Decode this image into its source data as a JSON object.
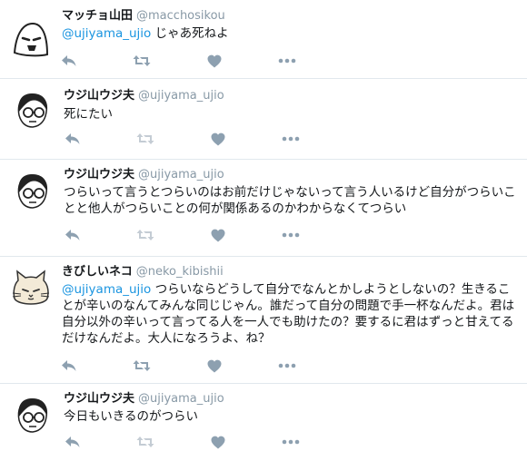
{
  "tweets": [
    {
      "name": "マッチョ山田",
      "handle": "@macchosikou",
      "mention": "@ujiyama_ujio",
      "text": " じゃあ死ねよ",
      "avatar": "ghost-face-icon",
      "retweet_active": true
    },
    {
      "name": "ウジ山ウジ夫",
      "handle": "@ujiyama_ujio",
      "mention": "",
      "text": "死にたい",
      "avatar": "glasses-man-icon",
      "retweet_active": false
    },
    {
      "name": "ウジ山ウジ夫",
      "handle": "@ujiyama_ujio",
      "mention": "",
      "text": "つらいって言うとつらいのはお前だけじゃないって言う人いるけど自分がつらいことと他人がつらいことの何が関係あるのかわからなくてつらい",
      "avatar": "glasses-man-icon",
      "retweet_active": false
    },
    {
      "name": "きびしいネコ",
      "handle": "@neko_kibishii",
      "mention": "@ujiyama_ujio",
      "text": " つらいならどうして自分でなんとかしようとしないの？生きることが辛いのなんてみんな同じじゃん。誰だって自分の問題で手一杯なんだよ。君は自分以外の辛いって言ってる人を一人でも助けたの？要するに君はずっと甘えてるだけなんだよ。大人になろうよ、ね？",
      "avatar": "cat-face-icon",
      "retweet_active": true
    },
    {
      "name": "ウジ山ウジ夫",
      "handle": "@ujiyama_ujio",
      "mention": "",
      "text": "今日もいきるのがつらい",
      "avatar": "glasses-man-icon",
      "retweet_active": false
    }
  ],
  "colors": {
    "action_icon": "#8da0b0",
    "action_icon_disabled": "#c4ccd4",
    "mention": "#1b95e0",
    "handle": "#8899a6",
    "divider": "#e1e8ed"
  }
}
